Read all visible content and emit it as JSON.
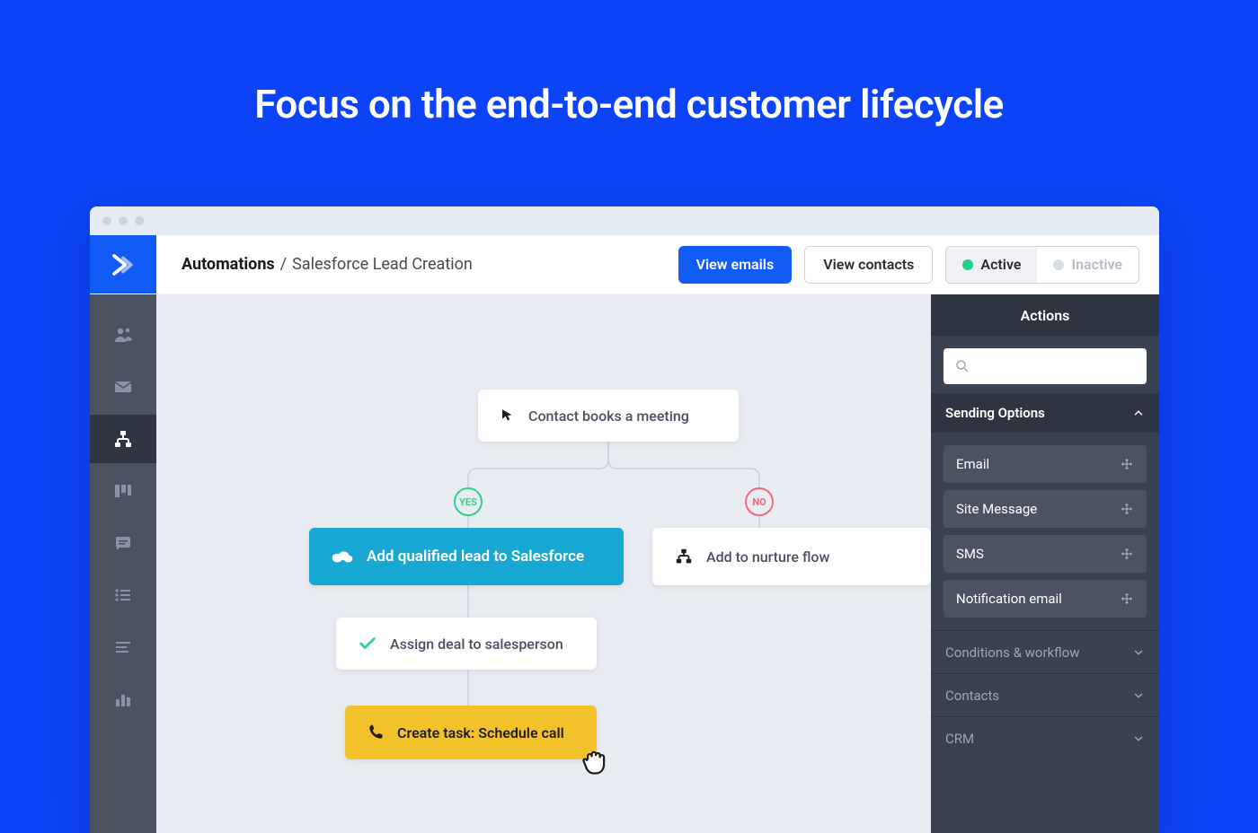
{
  "headline": "Focus on the end-to-end customer lifecycle",
  "breadcrumb": {
    "root": "Automations",
    "sep": "/",
    "leaf": "Salesforce Lead Creation"
  },
  "topbar": {
    "view_emails": "View emails",
    "view_contacts": "View contacts",
    "toggle": {
      "active_label": "Active",
      "inactive_label": "Inactive",
      "active_color": "#1fd18b",
      "inactive_color": "#d8dde6"
    }
  },
  "sidebar_icons": [
    "contacts",
    "email",
    "automations",
    "deals",
    "comments",
    "lists",
    "text",
    "reports"
  ],
  "flow": {
    "trigger_label": "Contact books a meeting",
    "yes_label": "YES",
    "no_label": "NO",
    "salesforce_label": "Add qualified lead to Salesforce",
    "nurture_label": "Add to nurture flow",
    "assign_label": "Assign deal to salesperson",
    "task_label": "Create task: Schedule call"
  },
  "panel": {
    "title": "Actions",
    "search_placeholder": "",
    "open_section": "Sending Options",
    "actions": [
      "Email",
      "Site Message",
      "SMS",
      "Notification email"
    ],
    "collapsed": [
      "Conditions & workflow",
      "Contacts",
      "CRM"
    ]
  }
}
